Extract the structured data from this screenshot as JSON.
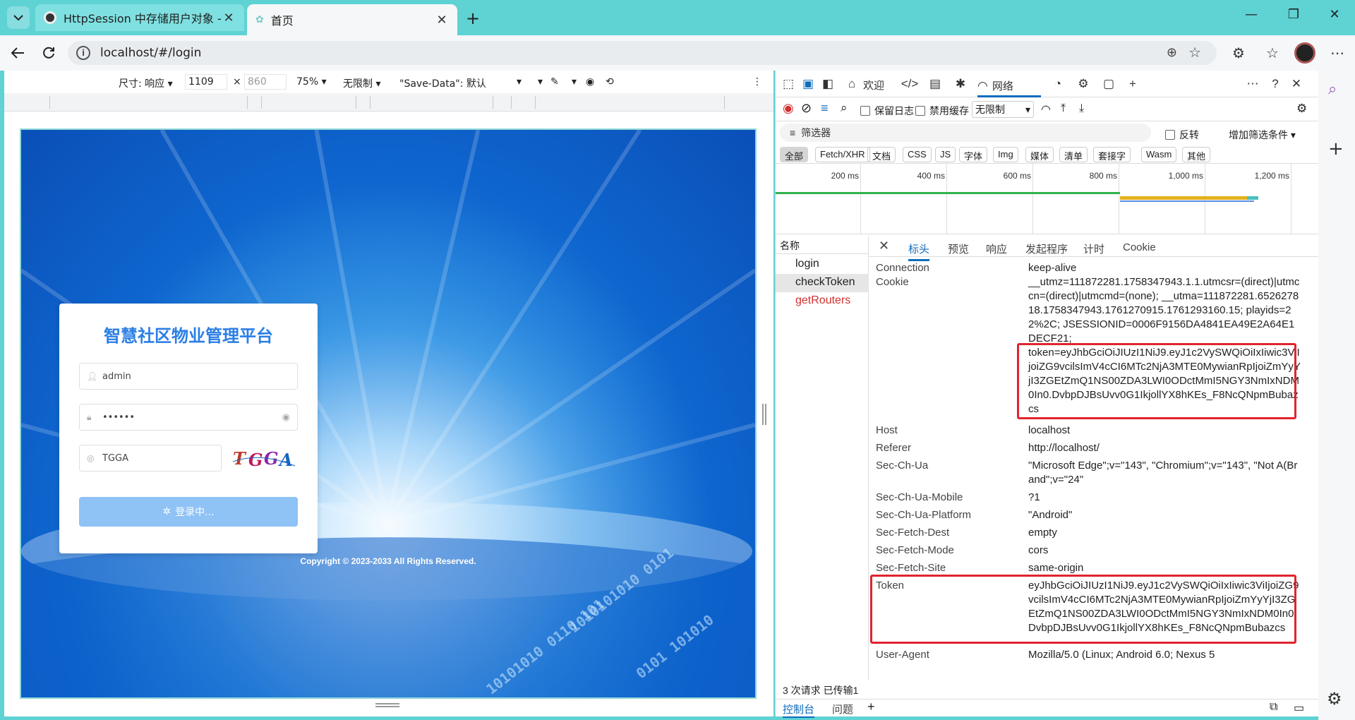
{
  "browser": {
    "tabs": [
      {
        "title": "HttpSession 中存储用户对象 - 豆包"
      },
      {
        "title": "首页"
      }
    ],
    "url": "localhost/#/login"
  },
  "device_toolbar": {
    "dimensions_label": "尺寸: 响应",
    "width": "1109",
    "height": "860",
    "times": "×",
    "zoom": "75%",
    "throttle": "无限制",
    "save_data": "\"Save-Data\": 默认"
  },
  "login_page": {
    "title": "智慧社区物业管理平台",
    "username": "admin",
    "password_mask": "••••••",
    "captcha_value": "TGGA",
    "captcha_image_text": "TGGA",
    "login_button": "登录中...",
    "copyright": "Copyright © 2023-2033 All Rights Reserved."
  },
  "devtools": {
    "tabs": [
      "欢迎",
      "网络"
    ],
    "network_toolbar": {
      "preserve_log": "保留日志",
      "disable_cache": "禁用缓存",
      "throttle": "无限制"
    },
    "filter": {
      "placeholder": "筛选器",
      "invert": "反转",
      "more_filters": "增加筛选条件"
    },
    "type_chips": [
      "全部",
      "Fetch/XHR",
      "文档",
      "CSS",
      "JS",
      "字体",
      "Img",
      "媒体",
      "清单",
      "套接字",
      "Wasm",
      "其他"
    ],
    "timeline_ticks": [
      "200 ms",
      "400 ms",
      "600 ms",
      "800 ms",
      "1,000 ms",
      "1,200 ms"
    ],
    "request_list_header": "名称",
    "requests": [
      "login",
      "checkToken",
      "getRouters"
    ],
    "detail_tabs": [
      "标头",
      "预览",
      "响应",
      "发起程序",
      "计时",
      "Cookie"
    ],
    "headers": [
      {
        "key": "Connection",
        "value": "keep-alive"
      },
      {
        "key": "Cookie",
        "value": "__utmz=111872281.1758347943.1.1.utmcsr=(direct)|utmccn=(direct)|utmcmd=(none); __utma=111872281.652627818.1758347943.1761270915.1761293160.15; playids=22%2C; JSESSIONID=0006F9156DA4841EA49E2A64E1DECF21;"
      },
      {
        "key": "",
        "value": "token=eyJhbGciOiJIUzI1NiJ9.eyJ1c2VySWQiOiIxIiwic3ViIjoiZG9vcilsImV4cCI6MTc2NjA3MTE0MywianRpIjoiZmYyYjI3ZGEtZmQ1NS00ZDA3LWI0ODctMmI5NGY3NmIxNDM0In0.DvbpDJBsUvv0G1IkjollYX8hKEs_F8NcQNpmBubazcs"
      },
      {
        "key": "Host",
        "value": "localhost"
      },
      {
        "key": "Referer",
        "value": "http://localhost/"
      },
      {
        "key": "Sec-Ch-Ua",
        "value": "\"Microsoft Edge\";v=\"143\", \"Chromium\";v=\"143\", \"Not A(Brand\";v=\"24\""
      },
      {
        "key": "Sec-Ch-Ua-Mobile",
        "value": "?1"
      },
      {
        "key": "Sec-Ch-Ua-Platform",
        "value": "\"Android\""
      },
      {
        "key": "Sec-Fetch-Dest",
        "value": "empty"
      },
      {
        "key": "Sec-Fetch-Mode",
        "value": "cors"
      },
      {
        "key": "Sec-Fetch-Site",
        "value": "same-origin"
      },
      {
        "key": "Token",
        "value": "eyJhbGciOiJIUzI1NiJ9.eyJ1c2VySWQiOiIxIiwic3ViIjoiZG9vcilsImV4cCI6MTc2NjA3MTE0MywianRpIjoiZmYyYjI3ZGEtZmQ1NS00ZDA3LWI0ODctMmI5NGY3NmIxNDM0In0.DvbpDJBsUvv0G1IkjollYX8hKEs_F8NcQNpmBubazcs"
      },
      {
        "key": "User-Agent",
        "value": "Mozilla/5.0 (Linux; Android 6.0; Nexus 5"
      }
    ],
    "status_bar": "3 次请求   已传输1",
    "drawer_tabs": [
      "控制台",
      "问题"
    ]
  }
}
